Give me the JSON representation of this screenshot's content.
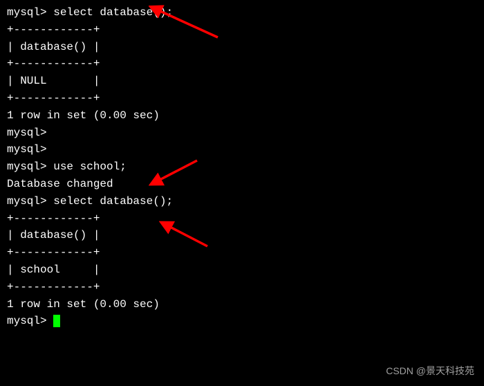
{
  "terminal": {
    "prompt": "mysql>",
    "lines": [
      "mysql> select database();",
      "+------------+",
      "| database() |",
      "+------------+",
      "| NULL       |",
      "+------------+",
      "1 row in set (0.00 sec)",
      "",
      "mysql>",
      "mysql>",
      "mysql> use school;",
      "Database changed",
      "mysql> select database();",
      "+------------+",
      "| database() |",
      "+------------+",
      "| school     |",
      "+------------+",
      "1 row in set (0.00 sec)",
      ""
    ],
    "final_prompt": "mysql> "
  },
  "annotations": {
    "arrow_color": "#ff0000"
  },
  "watermark": "CSDN @景天科技苑"
}
